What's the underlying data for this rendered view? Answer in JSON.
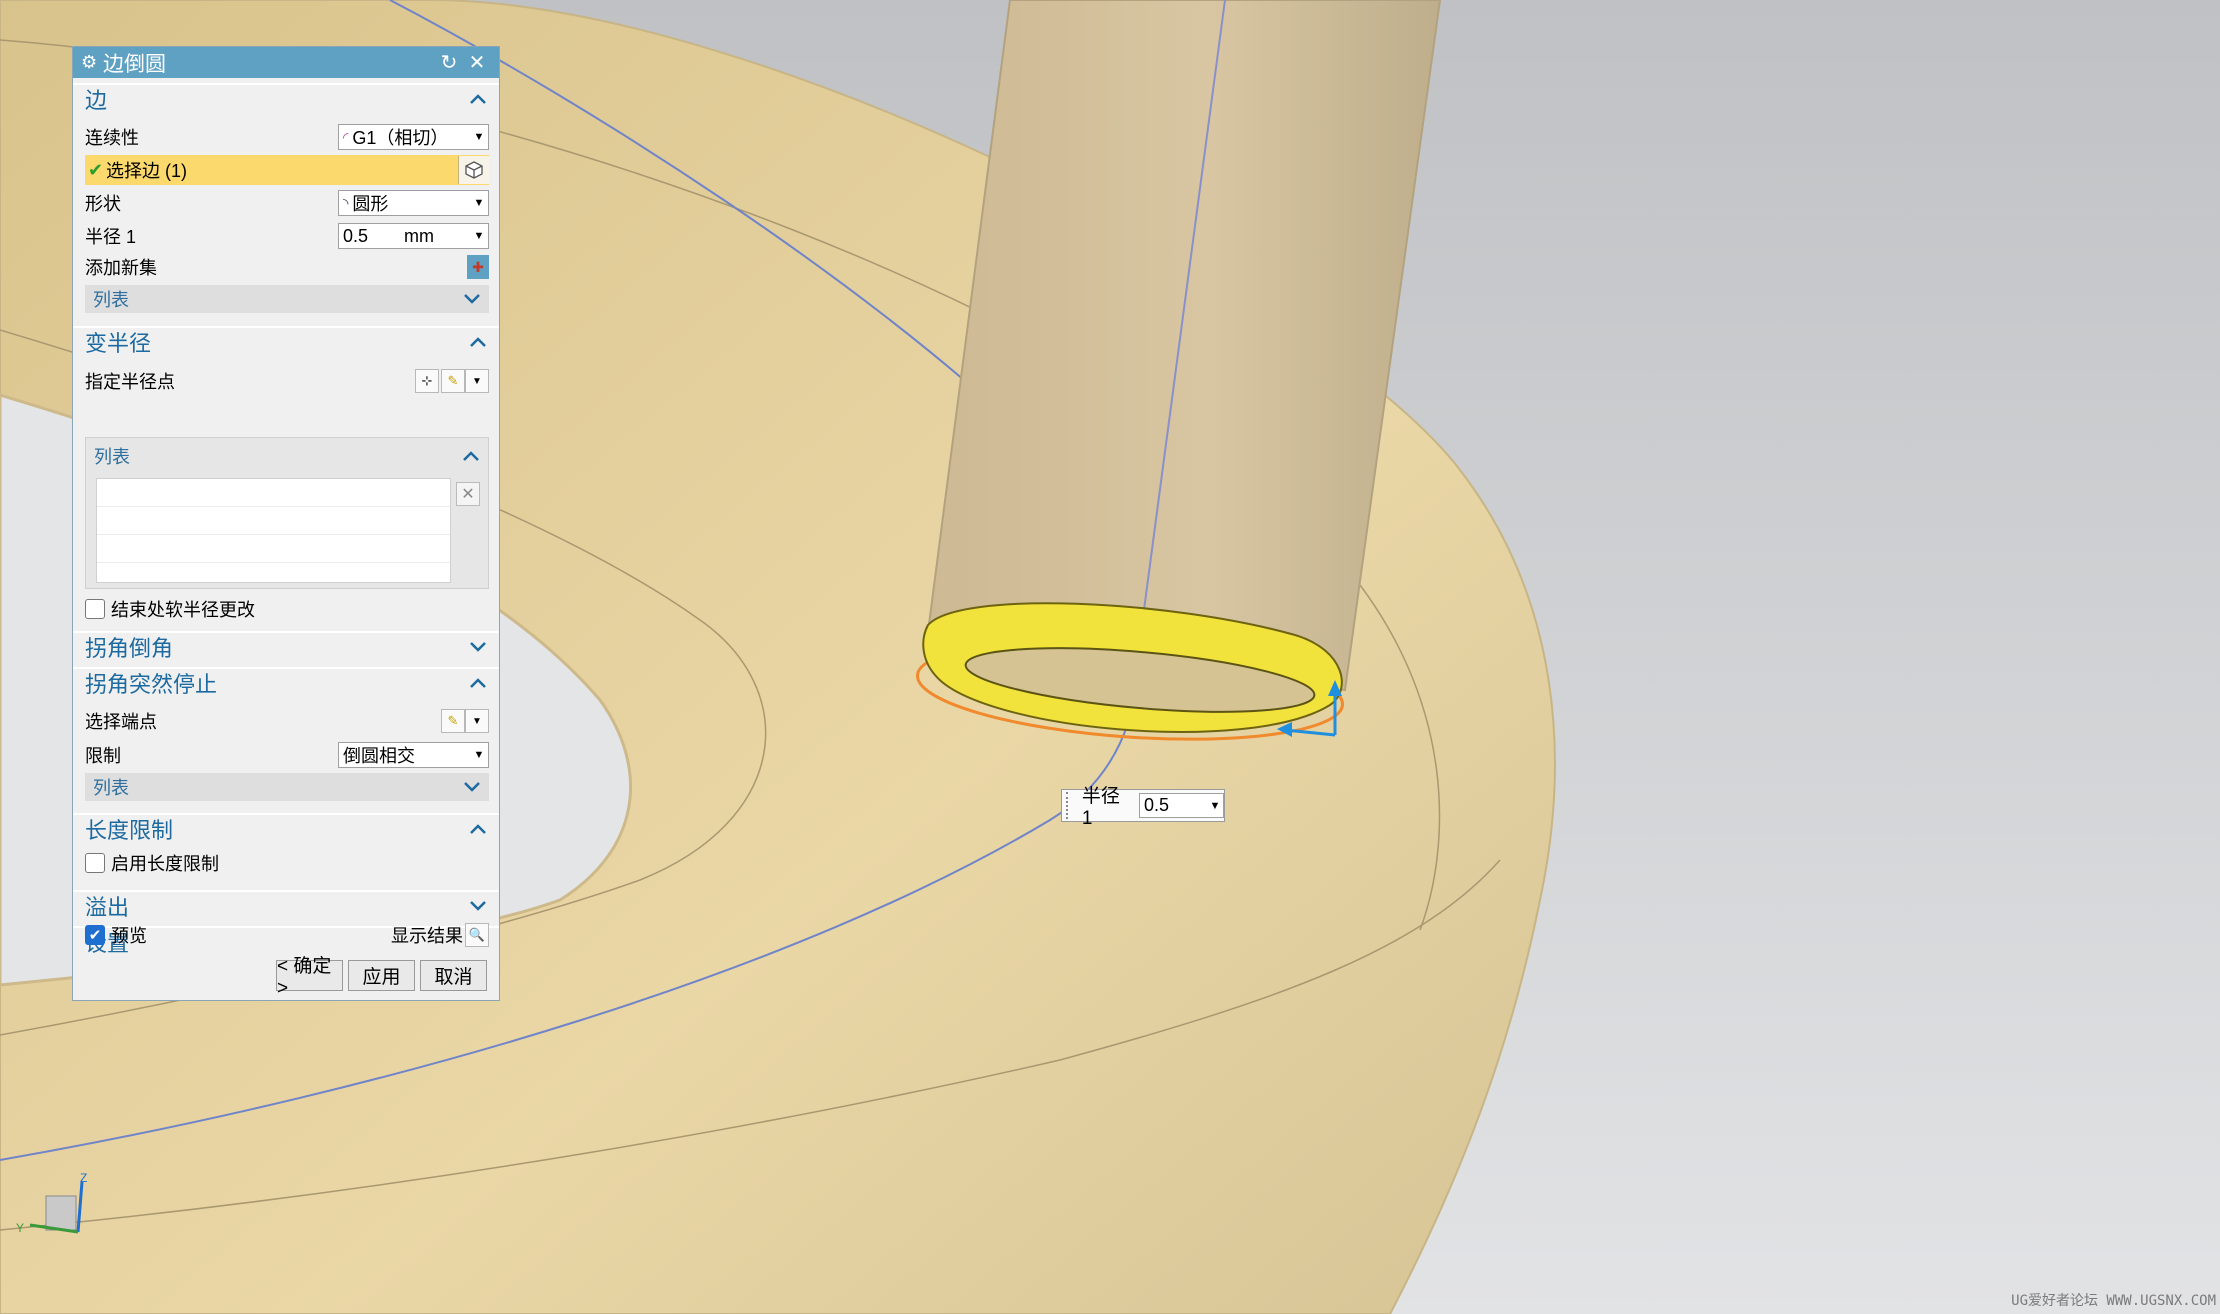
{
  "dialog": {
    "title": "边倒圆",
    "icons": {
      "title": "gear-icon",
      "reset": "reset-icon",
      "close": "close-icon"
    },
    "sections": {
      "edge": {
        "title": "边",
        "continuity_label": "连续性",
        "continuity_value": "G1（相切）",
        "select_edge_label": "选择边 (1)",
        "shape_label": "形状",
        "shape_value": "圆形",
        "radius_label": "半径 1",
        "radius_value": "0.5",
        "radius_unit": "mm",
        "add_set_label": "添加新集",
        "list_label": "列表"
      },
      "variable_radius": {
        "title": "变半径",
        "specify_point_label": "指定半径点",
        "list_label": "列表",
        "soft_change_label": "结束处软半径更改",
        "soft_change_checked": false
      },
      "corner_setback": {
        "title": "拐角倒角"
      },
      "corner_stop": {
        "title": "拐角突然停止",
        "select_end_label": "选择端点",
        "limit_label": "限制",
        "limit_value": "倒圆相交",
        "list_label": "列表"
      },
      "length_limit": {
        "title": "长度限制",
        "enable_label": "启用长度限制",
        "enable_checked": false
      },
      "overflow": {
        "title": "溢出"
      },
      "settings": {
        "title": "设置"
      }
    },
    "preview_label": "预览",
    "preview_checked": true,
    "show_result_label": "显示结果",
    "buttons": {
      "ok": "< 确定 >",
      "apply": "应用",
      "cancel": "取消"
    }
  },
  "tooltip": {
    "label": "半径 1",
    "value": "0.5"
  },
  "triad": {
    "z": "Z",
    "y": "Y"
  },
  "watermark": "UG爱好者论坛 WWW.UGSNX.COM",
  "colors": {
    "title_bar": "#5fa1c3",
    "section_text": "#1d6aa0",
    "selection_highlight": "#fbd96d",
    "part_body": "#ecd9a6",
    "fillet_face": "#f2e23c",
    "edge_preview": "#f08a2c"
  }
}
